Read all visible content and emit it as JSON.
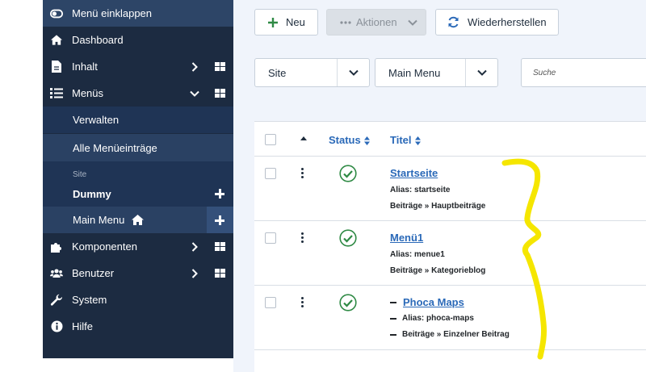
{
  "sidebar": {
    "toggle": "Menü einklappen",
    "dashboard": "Dashboard",
    "content": "Inhalt",
    "menus": "Menüs",
    "manage": "Verwalten",
    "all_items": "Alle Menüeinträge",
    "section_site": "Site",
    "dummy": "Dummy",
    "main_menu": "Main Menu",
    "components": "Komponenten",
    "users": "Benutzer",
    "system": "System",
    "help": "Hilfe"
  },
  "toolbar": {
    "new_label": "Neu",
    "actions_label": "Aktionen",
    "restore_label": "Wiederherstellen"
  },
  "filters": {
    "client": "Site",
    "menu": "Main Menu",
    "search_placeholder": "Suche"
  },
  "table": {
    "headers": {
      "status": "Status",
      "title": "Titel"
    },
    "rows": [
      {
        "title": "Startseite",
        "alias": "Alias: startseite",
        "type": "Beiträge » Hauptbeiträge"
      },
      {
        "title": "Menü1",
        "alias": "Alias: menue1",
        "type": "Beiträge » Kategorieblog"
      },
      {
        "title": "Phoca Maps",
        "alias": "Alias: phoca-maps",
        "type": "Beiträge » Einzelner Beitrag"
      }
    ]
  },
  "colors": {
    "sidebar_bg": "#1c2b41",
    "accent_blue": "#2a69b8",
    "success_green": "#2f8a45",
    "annotation_yellow": "#f5e600"
  }
}
